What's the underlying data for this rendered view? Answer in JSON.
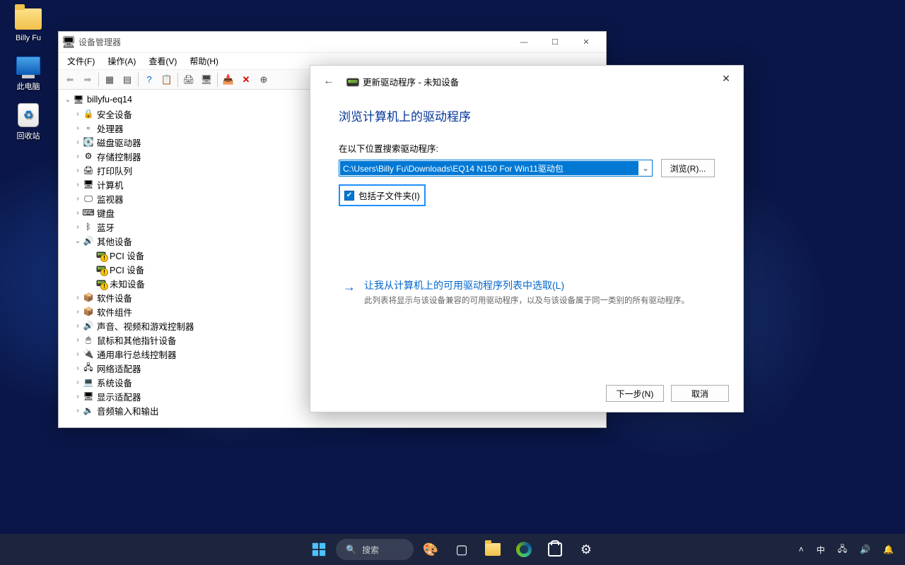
{
  "desktop": {
    "icons": [
      {
        "label": "Billy Fu",
        "type": "folder"
      },
      {
        "label": "此电脑",
        "type": "pc"
      },
      {
        "label": "回收站",
        "type": "bin"
      }
    ]
  },
  "devmgr": {
    "title": "设备管理器",
    "menu": {
      "file": "文件(F)",
      "action": "操作(A)",
      "view": "查看(V)",
      "help": "帮助(H)"
    },
    "root": "billyfu-eq14",
    "categories": [
      {
        "label": "安全设备",
        "icon": "🔒"
      },
      {
        "label": "处理器",
        "icon": "▫"
      },
      {
        "label": "磁盘驱动器",
        "icon": "💽"
      },
      {
        "label": "存储控制器",
        "icon": "⚙"
      },
      {
        "label": "打印队列",
        "icon": "🖨"
      },
      {
        "label": "计算机",
        "icon": "🖥"
      },
      {
        "label": "监视器",
        "icon": "🖵"
      },
      {
        "label": "键盘",
        "icon": "⌨"
      },
      {
        "label": "蓝牙",
        "icon": "ᛒ"
      }
    ],
    "other_devices": {
      "label": "其他设备",
      "children": [
        {
          "label": "PCI 设备"
        },
        {
          "label": "PCI 设备"
        },
        {
          "label": "未知设备"
        }
      ]
    },
    "categories2": [
      {
        "label": "软件设备",
        "icon": "📦"
      },
      {
        "label": "软件组件",
        "icon": "📦"
      },
      {
        "label": "声音、视频和游戏控制器",
        "icon": "🔊"
      },
      {
        "label": "鼠标和其他指针设备",
        "icon": "🖱"
      },
      {
        "label": "通用串行总线控制器",
        "icon": "🔌"
      },
      {
        "label": "网络适配器",
        "icon": "🖧"
      },
      {
        "label": "系统设备",
        "icon": "💻"
      },
      {
        "label": "显示适配器",
        "icon": "🖥"
      },
      {
        "label": "音频输入和输出",
        "icon": "🔉"
      }
    ]
  },
  "driverdlg": {
    "header": "更新驱动程序 - 未知设备",
    "title": "浏览计算机上的驱动程序",
    "search_label": "在以下位置搜索驱动程序:",
    "path": "C:\\Users\\Billy Fu\\Downloads\\EQ14 N150 For Win11驱动包",
    "browse": "浏览(R)...",
    "include_sub": "包括子文件夹(I)",
    "list_option_title": "让我从计算机上的可用驱动程序列表中选取(L)",
    "list_option_desc": "此列表将显示与该设备兼容的可用驱动程序，以及与该设备属于同一类别的所有驱动程序。",
    "next": "下一步(N)",
    "cancel": "取消"
  },
  "taskbar": {
    "search_placeholder": "搜索",
    "ime": "中"
  }
}
